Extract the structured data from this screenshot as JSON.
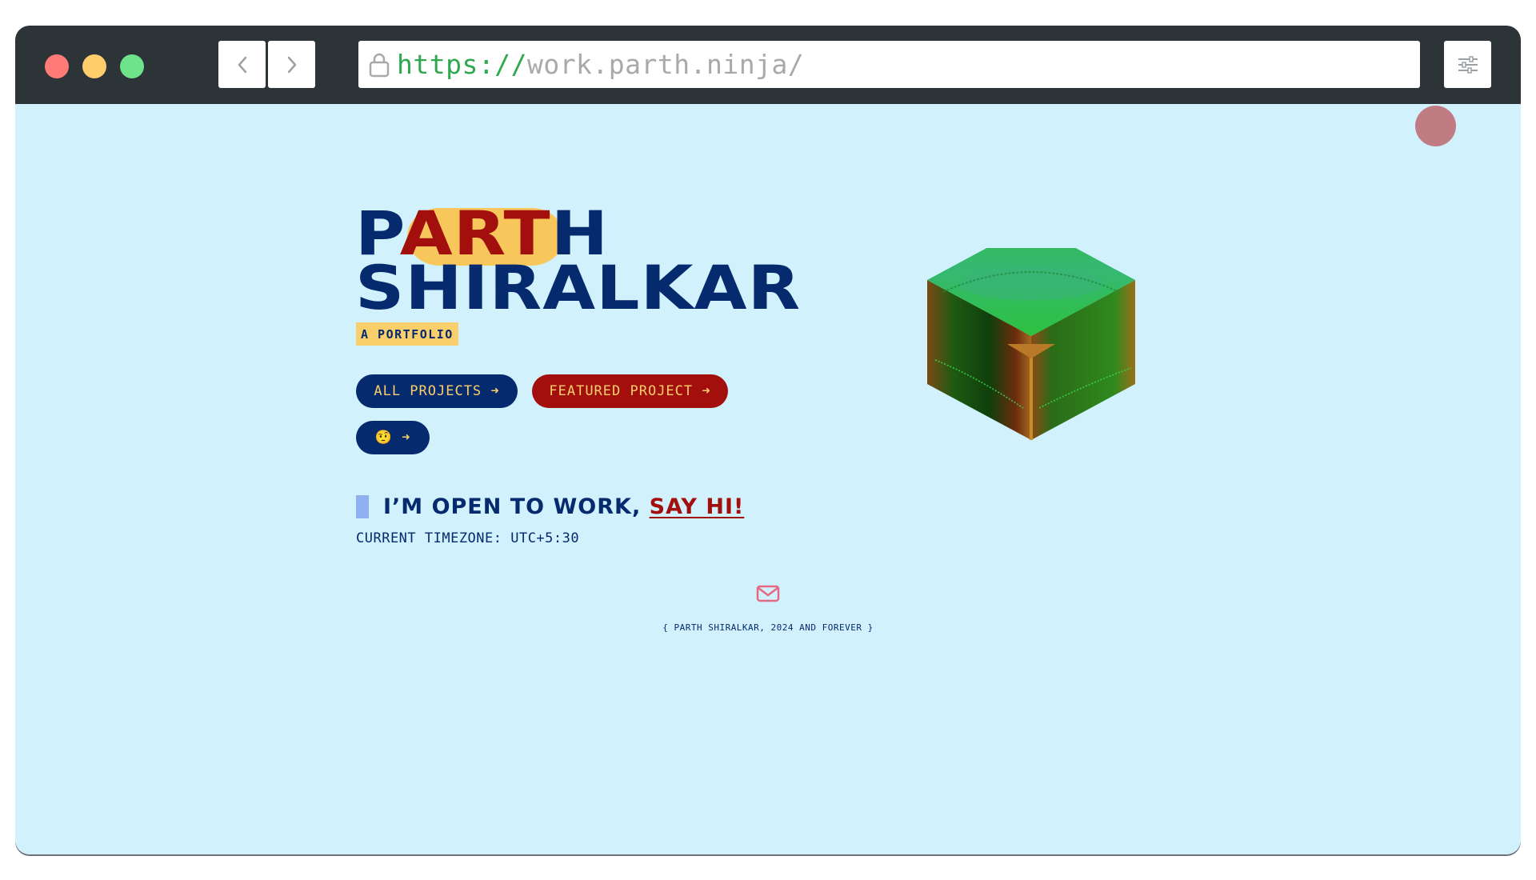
{
  "browser": {
    "url_protocol": "https://",
    "url_host": "work.parth.ninja/"
  },
  "hero": {
    "name_line1_start": "P",
    "name_line1_highlight": "ART",
    "name_line1_end": "H",
    "name_line2": "SHIRALKAR",
    "tag": "A PORTFOLIO"
  },
  "buttons": {
    "all_projects": "ALL PROJECTS ➜",
    "featured_project": "FEATURED PROJECT ➜",
    "emoji_button": "🤨 ➜"
  },
  "contact": {
    "open_text": "I’M OPEN TO WORK, ",
    "say_hi": "SAY HI!",
    "timezone": "CURRENT TIMEZONE: UTC+5:30"
  },
  "footer": {
    "note": "{ PARTH SHIRALKAR, 2024 AND FOREVER }"
  },
  "colors": {
    "navy": "#062a6e",
    "red": "#a30f0c",
    "yellow": "#f8cf6a",
    "sky": "#d1f2fd"
  },
  "icons": [
    "back-arrow-icon",
    "forward-arrow-icon",
    "lock-icon",
    "settings-sliders-icon",
    "mail-icon",
    "grass-cube-illustration"
  ]
}
